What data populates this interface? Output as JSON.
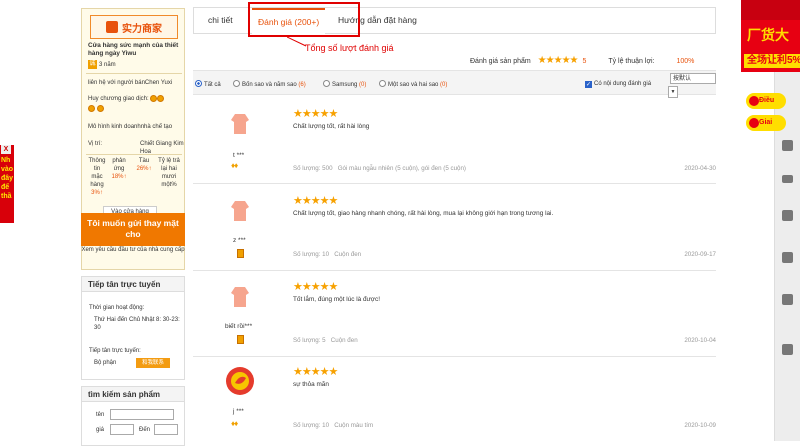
{
  "left_ad": {
    "close": "X",
    "text": "Nh vào đây để thầ"
  },
  "shop": {
    "badge": "实力商家",
    "title": "Cửa hàng sức mạnh của thiết hàng ngày Yiwu",
    "years": "3 năm",
    "contact": "liên hệ với người bánChen Yuxi",
    "medal_label": "Huy chương giao dịch:",
    "model": "Mô hình kinh doanhnhà chế tạo",
    "location_label": "Vị trí:",
    "location_value": "Chiết Giang Kim Hoa",
    "stats": [
      {
        "label": "Thông tin mặc hàng",
        "value": "3%↑"
      },
      {
        "label": "phản ứng",
        "value": "18%↑"
      },
      {
        "label": "Tàu",
        "value": "26%↑"
      },
      {
        "label": "Tỷ lệ trả lại",
        "value": "hai mươi một%"
      }
    ],
    "visit_label": "Vào cửa hàng",
    "want_button": "Tôi muốn gửi thay mặt cho",
    "pitch": "Xem yêu cầu đầu tư của nhà cung cấp"
  },
  "support": {
    "title": "Tiếp tân trực tuyến",
    "hours_label": "Thời gian hoạt động:",
    "hours_value": "Thứ Hai đến Chủ Nhật 8: 30-23: 30",
    "staff_label": "Tiếp tân trực tuyến:",
    "dept_label": "Bộ phận",
    "chat_label": "和我联系"
  },
  "product_search": {
    "title": "tìm kiếm sản phẩm",
    "name_label": "tên",
    "price_label": "giá",
    "to_label": "Đến"
  },
  "tabs": [
    {
      "label": "chi tiết",
      "active": false
    },
    {
      "label": "Đánh giá (200+)",
      "active": true
    },
    {
      "label": "Hướng dẫn đặt hàng",
      "active": false
    }
  ],
  "annotation": "Tổng số lượt đánh giá",
  "rating": {
    "product_label": "Đánh giá sản phẩm",
    "stars": "★★★★★",
    "score": "5",
    "favor_label": "Tỷ lệ thuận lợi:",
    "favor_value": "100%"
  },
  "filters": [
    {
      "label": "Tất cả",
      "count": "",
      "selected": true
    },
    {
      "label": "Bốn sao và năm sao",
      "count": "(6)",
      "selected": false
    },
    {
      "label": "Samsung",
      "count": "(0)",
      "selected": false
    },
    {
      "label": "Một sao và hai sao",
      "count": "(0)",
      "selected": false
    }
  ],
  "content_filter_label": "Có nội dung đánh giá",
  "sort_value": "按默认",
  "reviews": [
    {
      "user": "t ***",
      "stars": "★★★★★",
      "text": "Chất lượng tốt, rất hài lòng",
      "qty": "Số lượng: 500",
      "spec": "Gói màu ngẫu nhiên (5 cuộn), gói đen (5 cuộn)",
      "date": "2020-04-30",
      "level": "diamond"
    },
    {
      "user": "z ***",
      "stars": "★★★★★",
      "text": "Chất lượng tốt, giao hàng nhanh chóng, rất hài lòng, mua lại không giới hạn trong tương lai.",
      "qty": "Số lượng: 10",
      "spec": "Cuộn đen",
      "date": "2020-09-17",
      "level": "medal"
    },
    {
      "user": "biết rồi***",
      "stars": "★★★★★",
      "text": "Tốt lắm, đúng một lúc là được!",
      "qty": "Số lượng: 5",
      "spec": "Cuộn đen",
      "date": "2020-10-04",
      "level": "medal"
    },
    {
      "user": "j ***",
      "stars": "★★★★★",
      "text": "sự thỏa mãn",
      "qty": "Số lượng: 10",
      "spec": "Cuộn màu tím",
      "date": "2020-10-09",
      "level": "diamond"
    }
  ],
  "right_banner": {
    "title": "厂货大",
    "sub": "全场让利5%"
  },
  "right_pills": [
    "Điều",
    "Giai"
  ],
  "colors": {
    "accent": "#e8520c",
    "star": "#f7a100",
    "annotation": "#e00000",
    "banner": "#e70012"
  }
}
